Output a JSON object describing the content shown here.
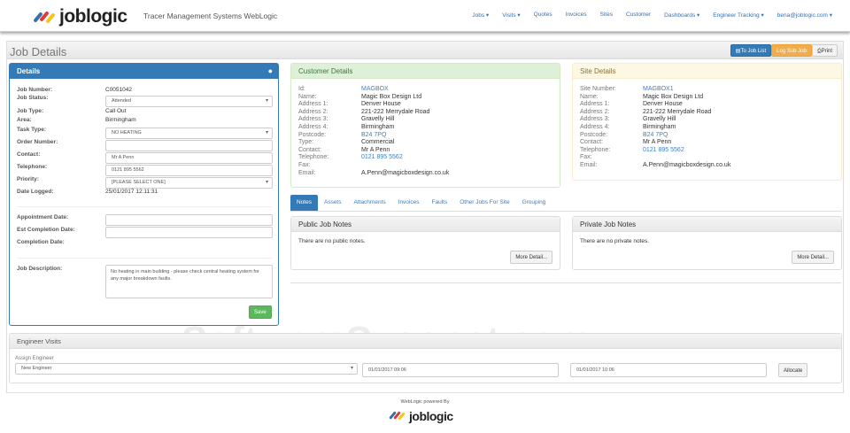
{
  "brand": {
    "name": "joblogic",
    "tagline": "Tracer Management Systems WebLogic"
  },
  "nav": [
    "Jobs ▾",
    "Visits ▾",
    "Quotes",
    "Invoices",
    "Sites",
    "Customer",
    "Dashboards ▾",
    "Engineer Tracking ▾",
    "bena@joblogic.com ▾"
  ],
  "page": {
    "title": "Job Details",
    "to_job_list": "To Job List",
    "log_sub_job": "Log Sub Job",
    "print": "Print"
  },
  "details": {
    "title": "Details",
    "job_number_label": "Job Number:",
    "job_number": "C0051042",
    "job_status_label": "Job Status:",
    "job_status": "Attended",
    "job_type_label": "Job Type:",
    "job_type": "Call Out",
    "area_label": "Area:",
    "area": "Birmingham",
    "task_type_label": "Task Type:",
    "task_type": "NO HEATING",
    "order_number_label": "Order Number:",
    "order_number": "",
    "contact_label": "Contact:",
    "contact": "Mr A Penn",
    "telephone_label": "Telephone:",
    "telephone": "0121 895 5562",
    "priority_label": "Priority:",
    "priority": "[PLEASE SELECT ONE]",
    "date_logged_label": "Date Logged:",
    "date_logged": "25/01/2017 12:11:31",
    "appointment_label": "Appointment Date:",
    "est_completion_label": "Est Completion Date:",
    "completion_label": "Completion Date:",
    "description_label": "Job Description:",
    "description": "No heating in main building - please check central heating system for any major breakdown faults.",
    "save": "Save"
  },
  "customer": {
    "title": "Customer Details",
    "rows": [
      {
        "k": "Id:",
        "v": "MAGBOX",
        "link": true
      },
      {
        "k": "Name:",
        "v": "Magic Box Design Ltd"
      },
      {
        "k": "Address 1:",
        "v": "Denver House"
      },
      {
        "k": "Address 2:",
        "v": "221-222 Merrydale Road"
      },
      {
        "k": "Address 3:",
        "v": "Gravelly Hill"
      },
      {
        "k": "Address 4:",
        "v": "Birmingham"
      },
      {
        "k": "Postcode:",
        "v": "B24 7PQ",
        "link": true
      },
      {
        "k": "Type:",
        "v": "Commercial"
      },
      {
        "k": "Contact:",
        "v": "Mr A Penn"
      },
      {
        "k": "Telephone:",
        "v": "0121 895 5562",
        "link": true
      },
      {
        "k": "Fax:",
        "v": ""
      },
      {
        "k": "Email:",
        "v": "A.Penn@magicboxdesign.co.uk"
      }
    ]
  },
  "site": {
    "title": "Site Details",
    "rows": [
      {
        "k": "Site Number:",
        "v": "MAGBOX1",
        "link": true
      },
      {
        "k": "Name:",
        "v": "Magic Box Design Ltd"
      },
      {
        "k": "Address 1:",
        "v": "Denver House"
      },
      {
        "k": "Address 2:",
        "v": "221-222 Merrydale Road"
      },
      {
        "k": "Address 3:",
        "v": "Gravelly Hill"
      },
      {
        "k": "Address 4:",
        "v": "Birmingham"
      },
      {
        "k": "Postcode:",
        "v": "B24 7PQ",
        "link": true
      },
      {
        "k": "Contact:",
        "v": "Mr A Penn"
      },
      {
        "k": "Telephone:",
        "v": "0121 895 5562",
        "link": true
      },
      {
        "k": "Fax:",
        "v": ""
      },
      {
        "k": "Email:",
        "v": "A.Penn@magicboxdesign.co.uk"
      }
    ]
  },
  "tabs": [
    "Notes",
    "Assets",
    "Attachments",
    "Invoices",
    "Faults",
    "Other Jobs For Site",
    "Grouping"
  ],
  "public_notes": {
    "title": "Public Job Notes",
    "text": "There are no public notes.",
    "button": "More Detail..."
  },
  "private_notes": {
    "title": "Private Job Notes",
    "text": "There are no private notes.",
    "button": "More Detail..."
  },
  "visits": {
    "title": "Engineer Visits",
    "assign_label": "Assign Engineer",
    "engineer": "New Engineer",
    "start": "01/01/2017 09:06",
    "end": "01/01/2017 10:06",
    "allocate": "Allocate"
  },
  "footer": {
    "text": "WebLogic powered By",
    "logo": "joblogic"
  },
  "watermark": "SoftwareSuggest.com",
  "colors": {
    "primary": "#337ab7",
    "warning": "#f0ad4e",
    "success": "#5cb85c"
  }
}
